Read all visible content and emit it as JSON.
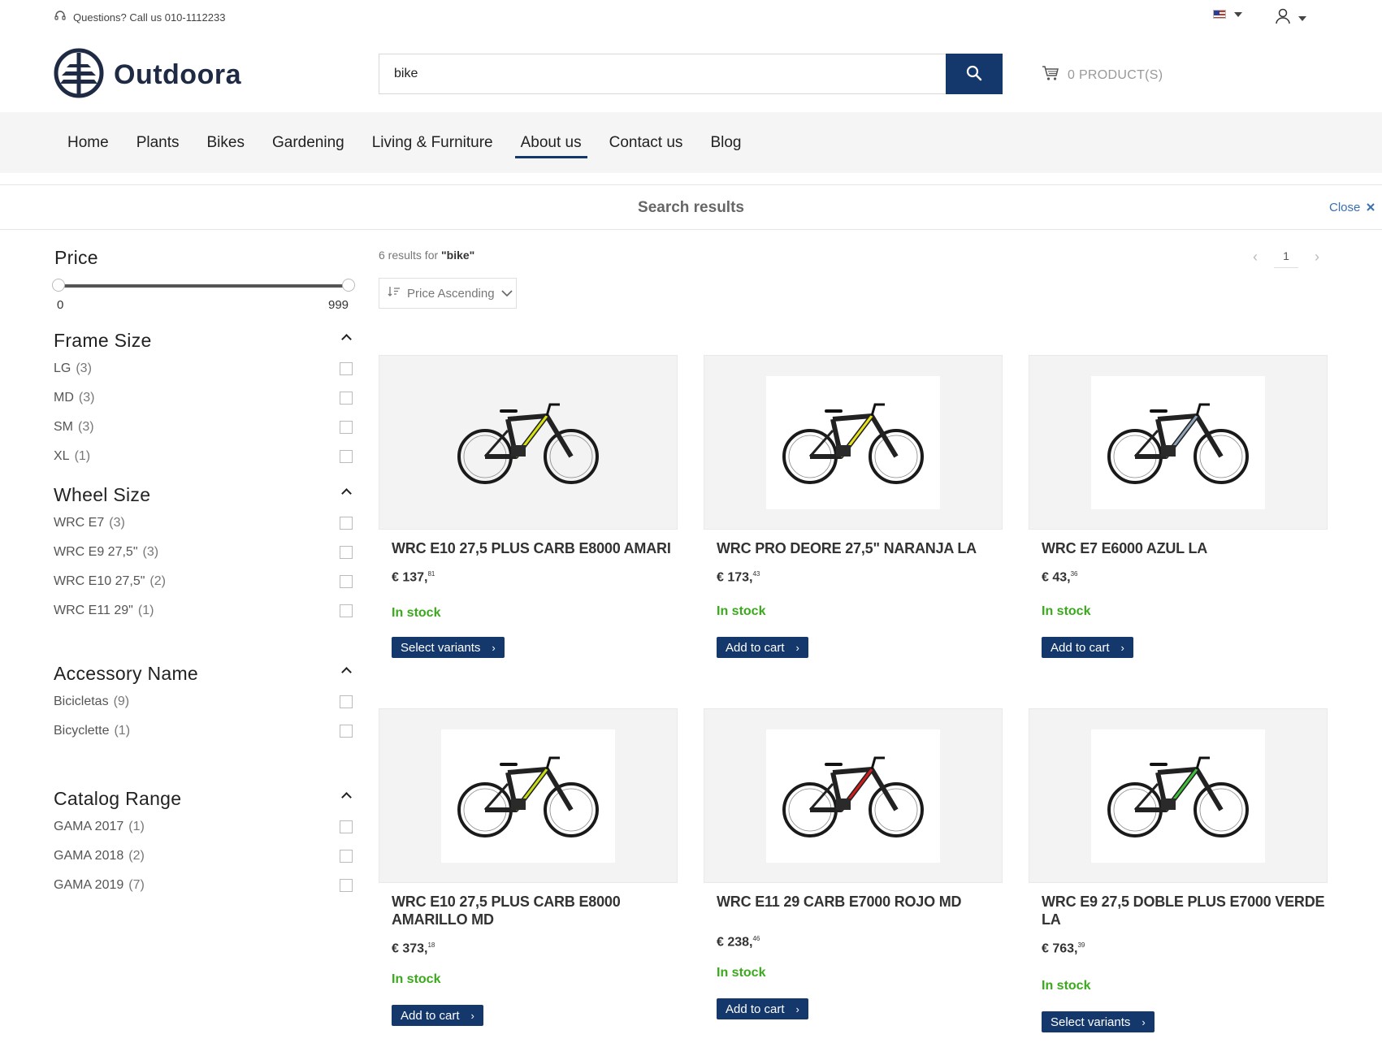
{
  "topbar": {
    "help_text": "Questions? Call us 010-1112233"
  },
  "header": {
    "logo_text": "Outdoora",
    "search_value": "bike",
    "cart_text": "0 PRODUCT(S)"
  },
  "nav": {
    "items": [
      "Home",
      "Plants",
      "Bikes",
      "Gardening",
      "Living & Furniture",
      "About us",
      "Contact us",
      "Blog"
    ],
    "active": "About us"
  },
  "results_bar": {
    "title": "Search results",
    "close_label": "Close"
  },
  "toolbar": {
    "count_prefix": "6 results for ",
    "query": "\"bike\"",
    "sort_label": "Price Ascending",
    "page": "1"
  },
  "filters": {
    "price": {
      "title": "Price",
      "min": "0",
      "max": "999"
    },
    "frame_size": {
      "title": "Frame Size",
      "items": [
        {
          "label": "LG",
          "count": "(3)"
        },
        {
          "label": "MD",
          "count": "(3)"
        },
        {
          "label": "SM",
          "count": "(3)"
        },
        {
          "label": "XL",
          "count": "(1)"
        }
      ]
    },
    "wheel_size": {
      "title": "Wheel Size",
      "items": [
        {
          "label": "WRC E7",
          "count": "(3)"
        },
        {
          "label": "WRC E9 27,5\"",
          "count": "(3)"
        },
        {
          "label": "WRC E10 27,5\"",
          "count": "(2)"
        },
        {
          "label": "WRC E11 29\"",
          "count": "(1)"
        }
      ]
    },
    "accessory_name": {
      "title": "Accessory Name",
      "items": [
        {
          "label": "Bicicletas",
          "count": "(9)"
        },
        {
          "label": "Bicyclette",
          "count": "(1)"
        }
      ]
    },
    "catalog_range": {
      "title": "Catalog Range",
      "items": [
        {
          "label": "GAMA 2017",
          "count": "(1)"
        },
        {
          "label": "GAMA 2018",
          "count": "(2)"
        },
        {
          "label": "GAMA 2019",
          "count": "(7)"
        }
      ]
    }
  },
  "products": [
    {
      "name": "WRC E10 27,5 PLUS CARB E8000 AMARI",
      "price_main": "€ 137,",
      "price_cents": "81",
      "stock": "In stock",
      "button": "Select variants",
      "accent": "#d7e20e"
    },
    {
      "name": "WRC PRO DEORE 27,5\" NARANJA LA",
      "price_main": "€ 173,",
      "price_cents": "43",
      "stock": "In stock",
      "button": "Add to cart",
      "accent": "#e8e31a"
    },
    {
      "name": "WRC E7 E6000 AZUL LA",
      "price_main": "€ 43,",
      "price_cents": "36",
      "stock": "In stock",
      "button": "Add to cart",
      "accent": "#8fa3b8"
    },
    {
      "name": "WRC E10 27,5 PLUS CARB E8000 AMARILLO MD",
      "price_main": "€ 373,",
      "price_cents": "18",
      "stock": "In stock",
      "button": "Add to cart",
      "accent": "#c7dd12"
    },
    {
      "name": "WRC E11 29 CARB E7000 ROJO MD",
      "price_main": "€ 238,",
      "price_cents": "46",
      "stock": "In stock",
      "button": "Add to cart",
      "accent": "#d21c1c"
    },
    {
      "name": "WRC E9 27,5 DOBLE PLUS E7000 VERDE LA",
      "price_main": "€ 763,",
      "price_cents": "39",
      "stock": "In stock",
      "button": "Select variants",
      "accent": "#3fbf3a"
    }
  ],
  "colors": {
    "brand": "#14386b",
    "stock_green": "#3aaa1c",
    "link_blue": "#3a6fb0"
  }
}
